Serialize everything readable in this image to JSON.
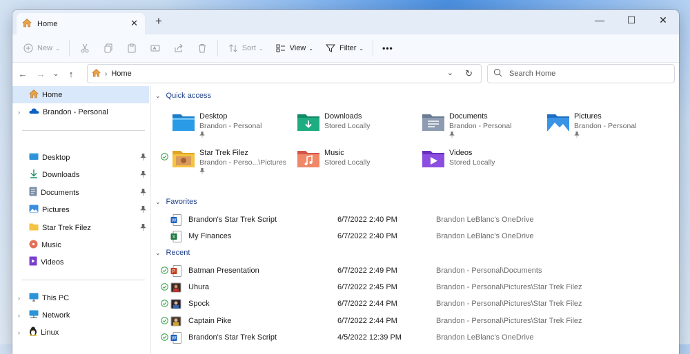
{
  "window": {
    "tab_title": "Home",
    "new_tab_symbol": "+",
    "close_tab_symbol": "✕",
    "controls": {
      "minimize": "—",
      "maximize": "☐",
      "close": "✕"
    }
  },
  "toolbar": {
    "new_label": "New",
    "sort_label": "Sort",
    "view_label": "View",
    "filter_label": "Filter",
    "more_label": "•••"
  },
  "address": {
    "path": "Home",
    "search_placeholder": "Search Home"
  },
  "sidebar": {
    "home": "Home",
    "onedrive": "Brandon - Personal",
    "pinned": [
      "Desktop",
      "Downloads",
      "Documents",
      "Pictures",
      "Star Trek Filez",
      "Music",
      "Videos"
    ],
    "this_pc": "This PC",
    "network": "Network",
    "linux": "Linux"
  },
  "quick_access": {
    "header": "Quick access",
    "items": [
      {
        "name": "Desktop",
        "sub": "Brandon - Personal",
        "icon": "desktop-folder-icon"
      },
      {
        "name": "Downloads",
        "sub": "Stored Locally",
        "icon": "downloads-folder-icon"
      },
      {
        "name": "Documents",
        "sub": "Brandon - Personal",
        "icon": "documents-folder-icon"
      },
      {
        "name": "Pictures",
        "sub": "Brandon - Personal",
        "icon": "pictures-folder-icon"
      },
      {
        "name": "Star Trek Filez",
        "sub": "Brandon - Perso...\\Pictures",
        "icon": "star-trek-folder-icon"
      },
      {
        "name": "Music",
        "sub": "Stored Locally",
        "icon": "music-folder-icon"
      },
      {
        "name": "Videos",
        "sub": "Stored Locally",
        "icon": "videos-folder-icon"
      }
    ]
  },
  "favorites": {
    "header": "Favorites",
    "rows": [
      {
        "name": "Brandon's Star Trek Script",
        "date": "6/7/2022 2:40 PM",
        "location": "Brandon LeBlanc's OneDrive",
        "icon": "word-icon"
      },
      {
        "name": "My Finances",
        "date": "6/7/2022 2:40 PM",
        "location": "Brandon LeBlanc's OneDrive",
        "icon": "excel-icon"
      }
    ]
  },
  "recent": {
    "header": "Recent",
    "rows": [
      {
        "name": "Batman Presentation",
        "date": "6/7/2022 2:49 PM",
        "location": "Brandon - Personal\\Documents",
        "icon": "powerpoint-icon"
      },
      {
        "name": "Uhura",
        "date": "6/7/2022 2:45 PM",
        "location": "Brandon - Personal\\Pictures\\Star Trek Filez",
        "icon": "image-file-icon"
      },
      {
        "name": "Spock",
        "date": "6/7/2022 2:44 PM",
        "location": "Brandon - Personal\\Pictures\\Star Trek Filez",
        "icon": "image-file-icon"
      },
      {
        "name": "Captain Pike",
        "date": "6/7/2022 2:44 PM",
        "location": "Brandon - Personal\\Pictures\\Star Trek Filez",
        "icon": "image-file-icon"
      },
      {
        "name": "Brandon's Star Trek Script",
        "date": "4/5/2022 12:39 PM",
        "location": "Brandon LeBlanc's OneDrive",
        "icon": "word-icon"
      }
    ]
  },
  "colors": {
    "accent": "#0067c0",
    "selection": "#d9e8fa",
    "section_header": "#1e3f8a",
    "sync_check": "#2e9d3f"
  }
}
